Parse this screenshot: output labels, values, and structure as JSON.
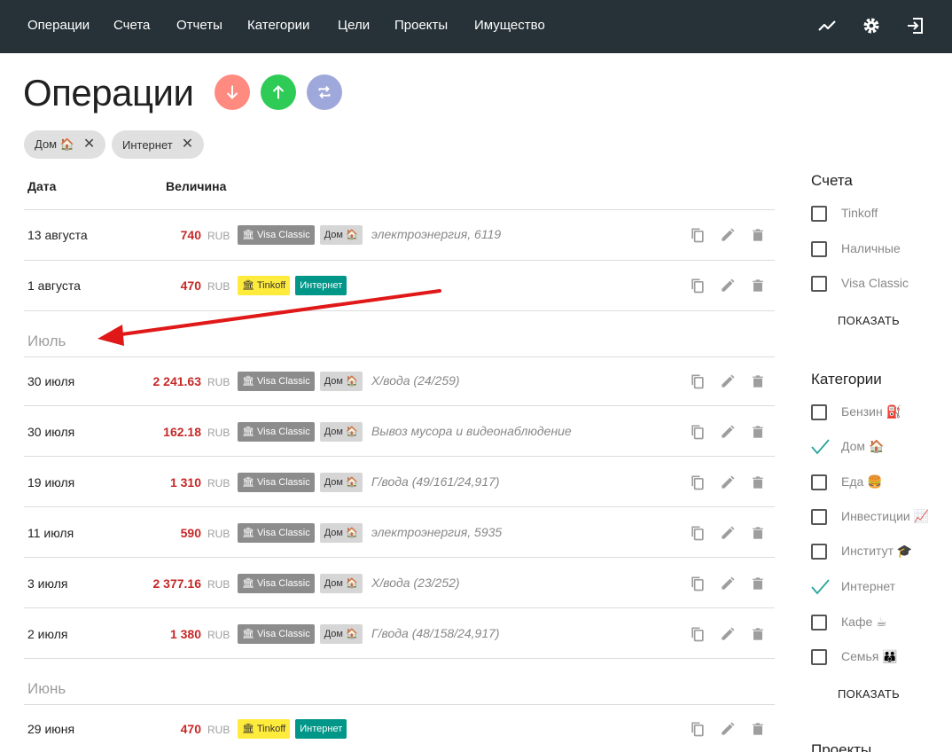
{
  "nav": {
    "links": [
      "Операции",
      "Счета",
      "Отчеты",
      "Категории",
      "Цели",
      "Проекты",
      "Имущество"
    ]
  },
  "page": {
    "title": "Операции"
  },
  "filters": [
    {
      "label": "Дом 🏠"
    },
    {
      "label": "Интернет"
    }
  ],
  "table": {
    "headers": {
      "date": "Дата",
      "amount": "Величина"
    },
    "currency": "RUB",
    "groups": [
      {
        "month": "",
        "rows": [
          {
            "date": "13 августа",
            "amount": "740",
            "account": "🏛 Visa Classic",
            "account_type": "visa",
            "category": "Дом 🏠",
            "category_type": "dom",
            "comment": "электроэнергия, 6119"
          },
          {
            "date": "1 августа",
            "amount": "470",
            "account": "🏛 Tinkoff",
            "account_type": "tinkoff",
            "category": "Интернет",
            "category_type": "net",
            "comment": ""
          }
        ]
      },
      {
        "month": "Июль",
        "rows": [
          {
            "date": "30 июля",
            "amount": "2 241.63",
            "account": "🏛 Visa Classic",
            "account_type": "visa",
            "category": "Дом 🏠",
            "category_type": "dom",
            "comment": "Х/вода (24/259)"
          },
          {
            "date": "30 июля",
            "amount": "162.18",
            "account": "🏛 Visa Classic",
            "account_type": "visa",
            "category": "Дом 🏠",
            "category_type": "dom",
            "comment": "Вывоз мусора и видеонаблюдение"
          },
          {
            "date": "19 июля",
            "amount": "1 310",
            "account": "🏛 Visa Classic",
            "account_type": "visa",
            "category": "Дом 🏠",
            "category_type": "dom",
            "comment": "Г/вода (49/161/24,917)"
          },
          {
            "date": "11 июля",
            "amount": "590",
            "account": "🏛 Visa Classic",
            "account_type": "visa",
            "category": "Дом 🏠",
            "category_type": "dom",
            "comment": "электроэнергия, 5935"
          },
          {
            "date": "3 июля",
            "amount": "2 377.16",
            "account": "🏛 Visa Classic",
            "account_type": "visa",
            "category": "Дом 🏠",
            "category_type": "dom",
            "comment": "Х/вода (23/252)"
          },
          {
            "date": "2 июля",
            "amount": "1 380",
            "account": "🏛 Visa Classic",
            "account_type": "visa",
            "category": "Дом 🏠",
            "category_type": "dom",
            "comment": "Г/вода (48/158/24,917)"
          }
        ]
      },
      {
        "month": "Июнь",
        "rows": [
          {
            "date": "29 июня",
            "amount": "470",
            "account": "🏛 Tinkoff",
            "account_type": "tinkoff",
            "category": "Интернет",
            "category_type": "net",
            "comment": ""
          }
        ]
      }
    ]
  },
  "sidebar": {
    "accounts": {
      "title": "Счета",
      "items": [
        {
          "label": "Tinkoff",
          "checked": false
        },
        {
          "label": "Наличные",
          "checked": false
        },
        {
          "label": "Visa Classic",
          "checked": false
        }
      ],
      "show_label": "ПОКАЗАТЬ"
    },
    "categories": {
      "title": "Категории",
      "items": [
        {
          "label": "Бензин ⛽",
          "checked": false
        },
        {
          "label": "Дом 🏠",
          "checked": true
        },
        {
          "label": "Еда 🍔",
          "checked": false
        },
        {
          "label": "Инвестиции 📈",
          "checked": false
        },
        {
          "label": "Институт 🎓",
          "checked": false
        },
        {
          "label": "Интернет",
          "checked": true
        },
        {
          "label": "Кафе ☕",
          "checked": false
        },
        {
          "label": "Семья 👪",
          "checked": false
        }
      ],
      "show_label": "ПОКАЗАТЬ"
    },
    "projects": {
      "title": "Проекты"
    }
  },
  "colors": {
    "navbar": "#263238",
    "expense": "#ff8a80",
    "income": "#2ecc57",
    "transfer": "#9fa8da",
    "amount": "#c62828",
    "checkmark": "#26a69a",
    "annotation_arrow": "#e01818"
  }
}
